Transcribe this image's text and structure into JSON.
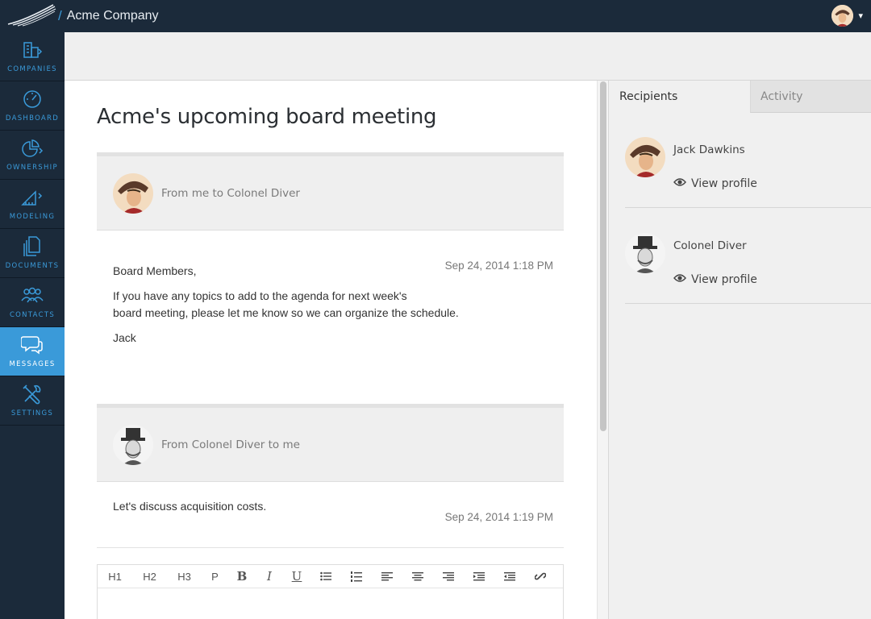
{
  "header": {
    "separator": "/",
    "company": "Acme Company",
    "logo_icon": "feather-logo-icon",
    "user_menu_icon": "chevron-down-icon"
  },
  "sidebar": {
    "items": [
      {
        "label": "COMPANIES",
        "icon": "buildings-icon",
        "active": false
      },
      {
        "label": "DASHBOARD",
        "icon": "gauge-icon",
        "active": false
      },
      {
        "label": "OWNERSHIP",
        "icon": "pie-chart-icon",
        "active": false
      },
      {
        "label": "MODELING",
        "icon": "ruler-triangle-icon",
        "active": false
      },
      {
        "label": "DOCUMENTS",
        "icon": "documents-icon",
        "active": false
      },
      {
        "label": "CONTACTS",
        "icon": "people-icon",
        "active": false
      },
      {
        "label": "MESSAGES",
        "icon": "chat-bubbles-icon",
        "active": true
      },
      {
        "label": "SETTINGS",
        "icon": "wrench-screwdriver-icon",
        "active": false
      }
    ]
  },
  "thread": {
    "title": "Acme's upcoming board meeting",
    "messages": [
      {
        "from": "From me to Colonel Diver",
        "date": "Sep 24, 2014 1:18 PM",
        "greeting": "Board Members,",
        "body_line1": "If you have any topics to add to the agenda for next week's",
        "body_line2": "board meeting, please let me know so we can organize the schedule.",
        "signoff": "Jack"
      },
      {
        "from": "From Colonel Diver to me",
        "date": "Sep 24, 2014 1:19 PM",
        "body": "Let's discuss acquisition costs."
      }
    ]
  },
  "editor": {
    "buttons": [
      {
        "label": "H1",
        "icon": "heading-1"
      },
      {
        "label": "H2",
        "icon": "heading-2"
      },
      {
        "label": "H3",
        "icon": "heading-3"
      },
      {
        "label": "P",
        "icon": "paragraph"
      },
      {
        "label": "B",
        "icon": "bold-icon"
      },
      {
        "label": "I",
        "icon": "italic-icon"
      },
      {
        "label": "U",
        "icon": "underline-icon"
      },
      {
        "label": "",
        "icon": "bullet-list-icon"
      },
      {
        "label": "",
        "icon": "numbered-list-icon"
      },
      {
        "label": "",
        "icon": "align-left-icon"
      },
      {
        "label": "",
        "icon": "align-center-icon"
      },
      {
        "label": "",
        "icon": "align-right-icon"
      },
      {
        "label": "",
        "icon": "indent-icon"
      },
      {
        "label": "",
        "icon": "outdent-icon"
      },
      {
        "label": "",
        "icon": "link-icon"
      }
    ]
  },
  "right_panel": {
    "tabs": [
      {
        "label": "Recipients",
        "active": true
      },
      {
        "label": "Activity",
        "active": false
      }
    ],
    "recipients": [
      {
        "name": "Jack Dawkins",
        "action": "View profile"
      },
      {
        "name": "Colonel Diver",
        "action": "View profile"
      }
    ]
  },
  "colors": {
    "nav_bg": "#1b2a3a",
    "accent": "#3a9ad9",
    "panel_bg": "#f0f0f0"
  }
}
